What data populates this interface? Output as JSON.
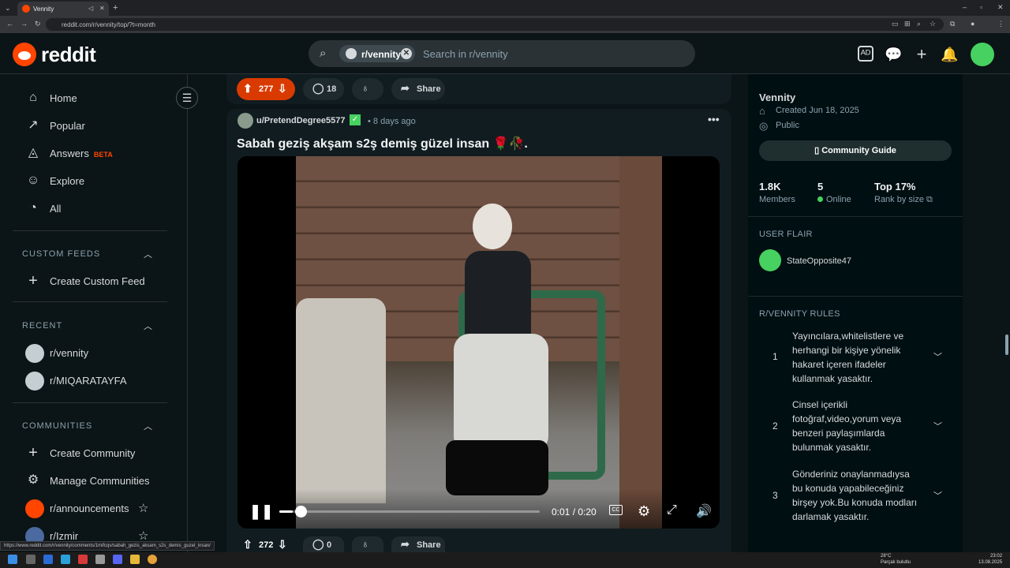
{
  "browser": {
    "tab_title": "Vennity",
    "url": "reddit.com/r/vennity/top/?t=month",
    "status_link": "https://www.reddit.com/r/vennity/comments/1mifcqv/sabah_gezis_aksam_s2s_demis_guzel_insan/"
  },
  "header": {
    "logo_text": "reddit",
    "search_chip": "r/vennity",
    "search_placeholder": "Search in r/vennity"
  },
  "sidebar": {
    "nav": [
      {
        "label": "Home",
        "icon": "home-icon"
      },
      {
        "label": "Popular",
        "icon": "popular-icon"
      },
      {
        "label": "Answers",
        "badge": "BETA",
        "icon": "answers-icon"
      },
      {
        "label": "Explore",
        "icon": "explore-icon"
      },
      {
        "label": "All",
        "icon": "all-icon"
      }
    ],
    "custom_feeds_heading": "CUSTOM FEEDS",
    "create_custom_feed": "Create Custom Feed",
    "recent_heading": "RECENT",
    "recent": [
      "r/vennity",
      "r/MIQARATAYFA"
    ],
    "communities_heading": "COMMUNITIES",
    "create_community": "Create Community",
    "manage_communities": "Manage Communities",
    "communities": [
      "r/announcements",
      "r/Izmir"
    ]
  },
  "prev_post": {
    "score": "277",
    "comments": "18",
    "share": "Share"
  },
  "post": {
    "author": "u/PretendDegree5577",
    "time": "• 8 days ago",
    "title": "Sabah geziş akşam s2ş demiş güzel insan 🌹🥀.",
    "video_time": "0:01 / 0:20",
    "video_progress": 0.05,
    "score": "272",
    "comments": "0",
    "share": "Share"
  },
  "community": {
    "name": "Vennity",
    "created": "Created Jun 18, 2025",
    "visibility": "Public",
    "guide_button": "Community Guide",
    "stats": [
      {
        "value": "1.8K",
        "label": "Members"
      },
      {
        "value": "5",
        "label": "Online"
      },
      {
        "value": "Top 17%",
        "label": "Rank by size"
      }
    ],
    "user_flair_heading": "USER FLAIR",
    "flair_user": "StateOpposite47",
    "rules_heading": "R/VENNITY RULES",
    "rules": [
      {
        "num": "1",
        "text": "Yayıncılara,whitelistlere ve herhangi bir kişiye yönelik hakaret içeren ifadeler kullanmak yasaktır."
      },
      {
        "num": "2",
        "text": "Cinsel içerikli fotoğraf,video,yorum veya benzeri paylaşımlarda bulunmak yasaktır."
      },
      {
        "num": "3",
        "text": "Gönderiniz onaylanmadıysa bu konuda yapabileceğiniz birşey yok.Bu konuda modları darlamak yasaktır."
      }
    ]
  },
  "taskbar": {
    "weather_temp": "28°C",
    "weather_desc": "Parçalı bulutlu",
    "time": "23:02",
    "date": "13.08.2025"
  },
  "colors": {
    "accent": "#ff4500",
    "online": "#46d160",
    "background": "#0b1416"
  }
}
